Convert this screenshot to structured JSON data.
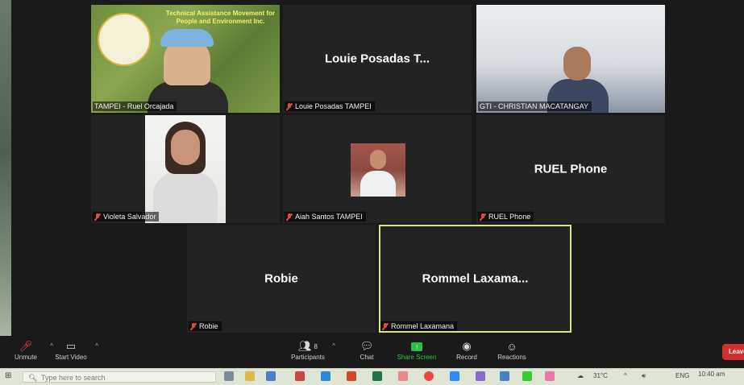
{
  "meeting": {
    "tiles": [
      {
        "id": "ruel",
        "label": "TAMPEI - Ruel Orcajada",
        "video": true,
        "muted": false,
        "org_text": "Technical Assistance Movement for People and Environment Inc.",
        "logo_text": "TAMPEI"
      },
      {
        "id": "louie",
        "label": "Louie Posadas TAMPEI",
        "display_name": "Louie Posadas T...",
        "muted": true
      },
      {
        "id": "christian",
        "label": "GTI - CHRISTIAN MACATANGAY",
        "video": true,
        "muted": false
      },
      {
        "id": "violeta",
        "label": "Violeta Salvador",
        "video": true,
        "muted": true
      },
      {
        "id": "aiah",
        "label": "Aiah Santos TAMPEI",
        "video": true,
        "muted": true
      },
      {
        "id": "ruelphone",
        "label": "RUEL Phone",
        "display_name": "RUEL Phone",
        "muted": true
      },
      {
        "id": "robie",
        "label": "Robie",
        "display_name": "Robie",
        "muted": true
      },
      {
        "id": "rommel",
        "label": "Rommel Laxamana",
        "display_name": "Rommel  Laxama...",
        "muted": true,
        "active_speaker": true
      }
    ]
  },
  "toolbar": {
    "unmute": "Unmute",
    "start_video": "Start Video",
    "participants": "Participants",
    "participants_count": "8",
    "chat": "Chat",
    "share_screen": "Share Screen",
    "record": "Record",
    "reactions": "Reactions",
    "leave": "Leave"
  },
  "taskbar": {
    "search_placeholder": "Type here to search",
    "weather": "31°C",
    "language": "ENG",
    "time": "10:40 am"
  },
  "colors": {
    "active_speaker_border": "#d9e67a",
    "share_green": "#27c24c",
    "leave_red": "#d32f2f",
    "muted_mic": "#e34b3b"
  }
}
